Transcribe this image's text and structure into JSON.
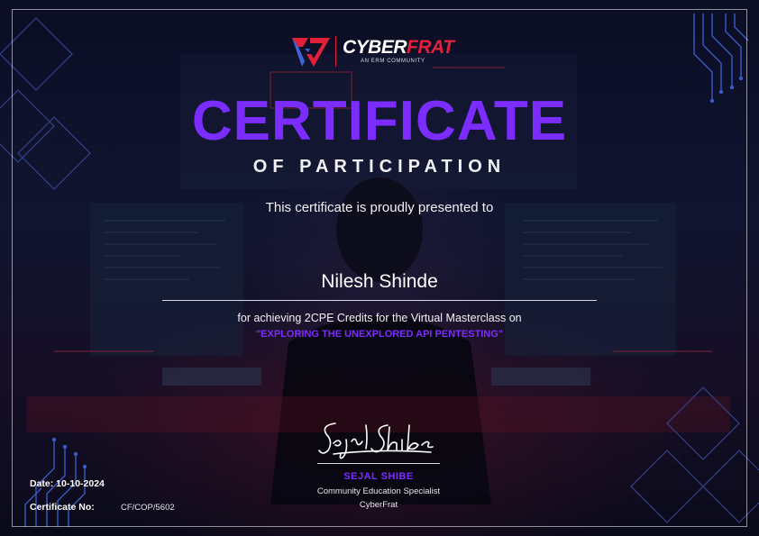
{
  "brand": {
    "name_part1": "CYBER",
    "name_part2": "FRAT",
    "tagline": "AN ERM COMMUNITY",
    "accent_color": "#e2203a",
    "icon": "cyberfrat-logo-icon"
  },
  "certificate": {
    "title": "CERTIFICATE",
    "subtitle": "OF PARTICIPATION",
    "presented_text": "This certificate is proudly presented to",
    "recipient": "Nilesh Shinde",
    "achievement_text": "for achieving 2CPE Credits for the Virtual Masterclass on",
    "topic": "\"EXPLORING THE UNEXPLORED API PENTESTING\"",
    "title_color": "#7b2cff"
  },
  "signatory": {
    "name": "SEJAL SHIBE",
    "role": "Community Education Specialist",
    "organization": "CyberFrat"
  },
  "details": {
    "date": "Date: 10-10-2024",
    "certificate_label": "Certificate No:",
    "certificate_number": "CF/COP/5602"
  }
}
